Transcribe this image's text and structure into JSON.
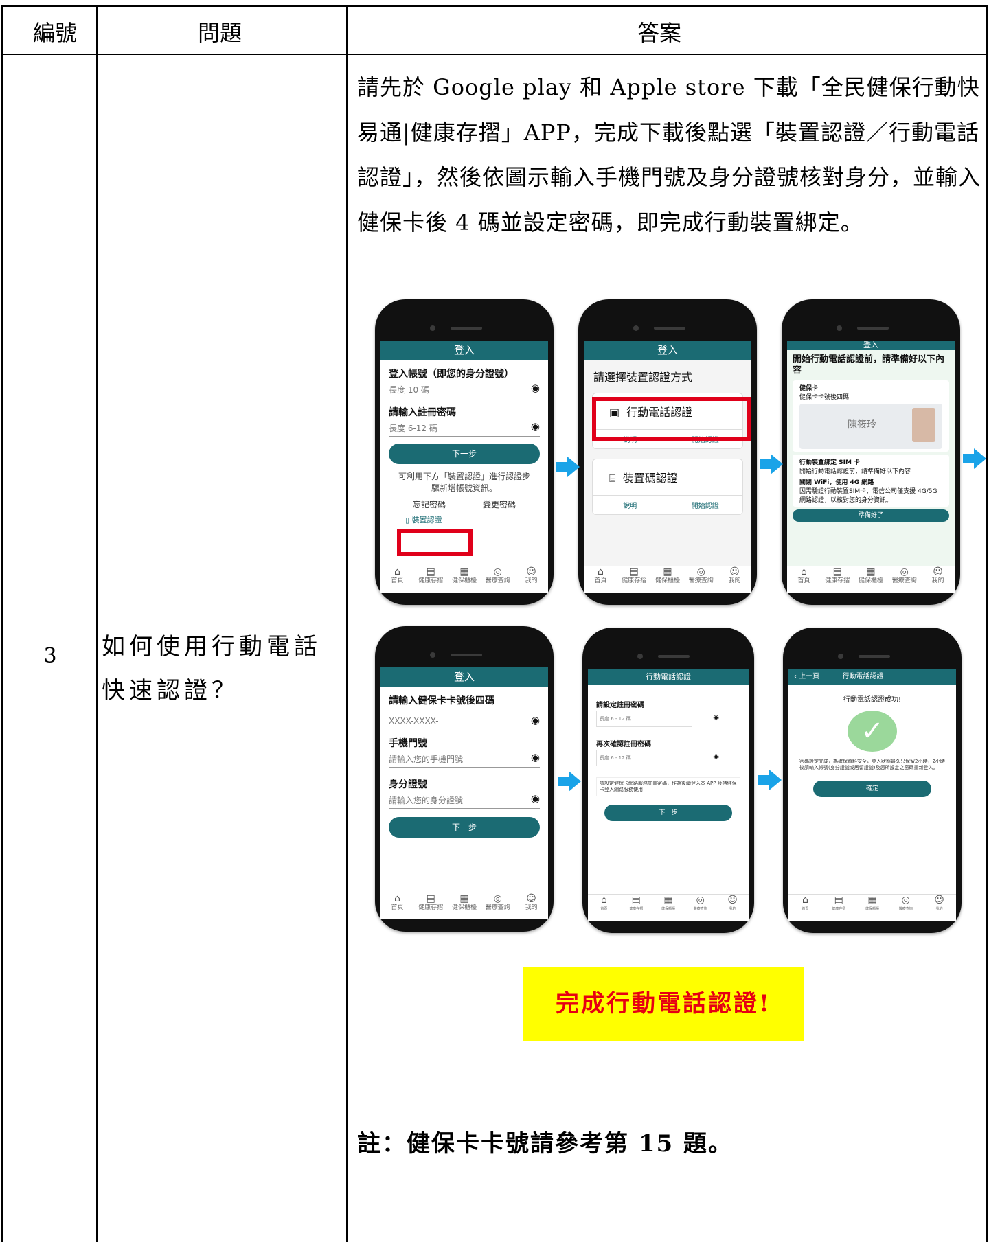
{
  "table": {
    "headers": [
      "編號",
      "問題",
      "答案"
    ],
    "row": {
      "number": "3",
      "question": "如何使用行動電話快速認證？",
      "answer_paragraph": "請先於 Google play 和 Apple store 下載「全民健保行動快易通|健康存摺」APP，完成下載後點選「裝置認證／行動電話認證」，然後依圖示輸入手機門號及身分證號核對身分，並輸入健保卡後 4 碼並設定密碼，即完成行動裝置綁定。",
      "completion_banner": "完成行動電話認證!",
      "note": "註：健保卡卡號請參考第 15 題。"
    }
  },
  "phones": {
    "p1": {
      "header": "登入",
      "account_label": "登入帳號（即您的身分證號）",
      "account_placeholder": "長度 10 碼",
      "password_label": "請輸入註冊密碼",
      "password_placeholder": "長度 6-12 碼",
      "next_button": "下一步",
      "hint": "可利用下方「裝置認證」進行認證步驟新增帳號資訊。",
      "forgot": "忘記密碼",
      "change": "變更密碼",
      "device_auth": "裝置認證"
    },
    "p2": {
      "header": "登入",
      "title": "請選擇裝置認證方式",
      "option1": "行動電話認證",
      "option2": "裝置碼認證",
      "explain": "說明",
      "start": "開始認證"
    },
    "p3": {
      "header": "登入",
      "title": "開始行動電話認證前，請準備好以下內容",
      "item1_title": "健保卡",
      "item1_sub": "健保卡卡號後四碼",
      "card_name": "陳筱玲",
      "item2_title": "行動裝置綁定 SIM 卡",
      "item2_sub": "開始行動電話認證前，請準備好以下內容",
      "item3_title": "關閉 WiFi，使用 4G 網路",
      "item3_sub": "因需驗證行動裝置SIM卡，電信公司僅支援 4G/5G 網路認證，以核對您的身分資訊。",
      "ready_button": "準備好了"
    },
    "p4": {
      "header": "登入",
      "card_label": "請輸入健保卡卡號後四碼",
      "card_value": "XXXX-XXXX-",
      "phone_label": "手機門號",
      "phone_placeholder": "請輸入您的手機門號",
      "id_label": "身分證號",
      "id_placeholder": "請輸入您的身分證號",
      "next_button": "下一步"
    },
    "p5": {
      "header": "行動電話認證",
      "pw_label": "請設定註冊密碼",
      "pw_placeholder": "長度 6 - 12 碼",
      "confirm_label": "再次確認註冊密碼",
      "confirm_placeholder": "長度 6 - 12 碼",
      "notice": "請設定健保卡網路服務註冊密碼，作為後續登入本 APP 及持健保卡登入網路服務使用",
      "next_button": "下一步"
    },
    "p6": {
      "back": "上一頁",
      "header": "行動電話認證",
      "success": "行動電話認證成功!",
      "message": "密碼設定完成，為確保資料安全，登入狀態最久只保留2小時，2小時後請輸入帳號(身分證號或居留證號)及您所設定之密碼重新登入。",
      "ok_button": "確定"
    },
    "tabbar": [
      "首頁",
      "健康存摺",
      "健保櫃檯",
      "醫療查詢",
      "我的"
    ]
  },
  "colors": {
    "teal": "#1b6b73",
    "arrow": "#1aa3e8",
    "highlight_red": "#e0001a",
    "banner_yellow": "#ffff00",
    "banner_text": "#e60012"
  }
}
